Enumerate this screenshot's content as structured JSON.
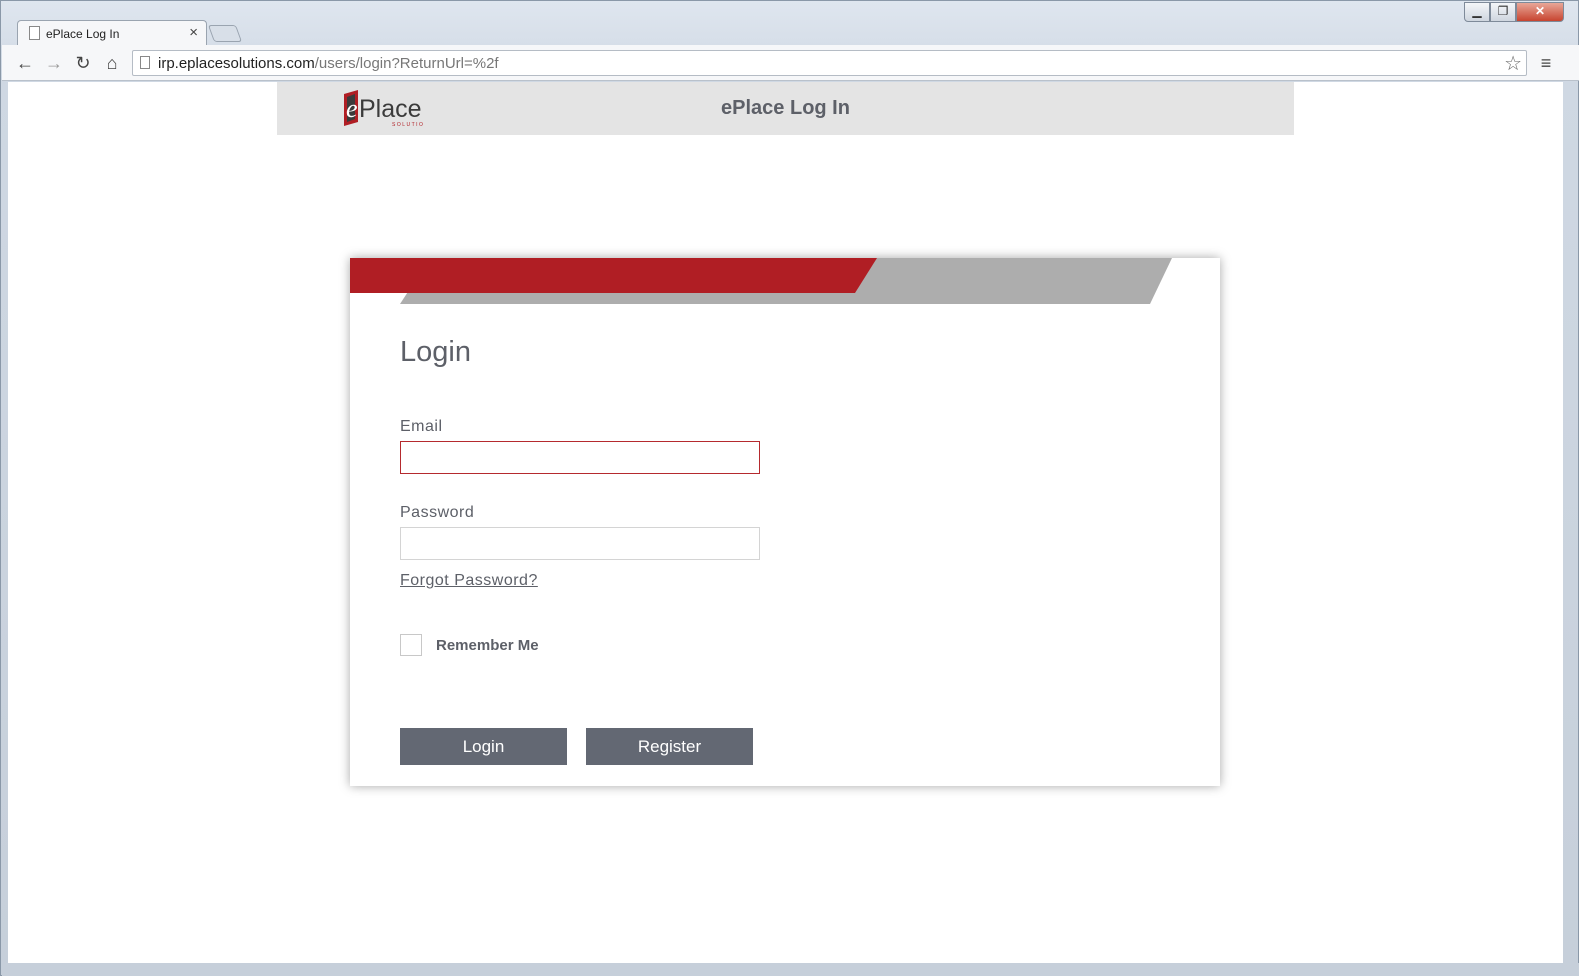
{
  "browser": {
    "tab_title": "ePlace Log In",
    "tab_close": "×",
    "url_host": "irp.eplacesolutions.com",
    "url_path": "/users/login?ReturnUrl=%2f",
    "back_glyph": "←",
    "forward_glyph": "→",
    "reload_glyph": "↻",
    "home_glyph": "⌂",
    "star_glyph": "☆",
    "menu_glyph": "≡",
    "win_min": "▁",
    "win_max": "❐",
    "win_close": "✕"
  },
  "header": {
    "logo_text": "ePlace",
    "logo_subtext": "SOLUTIONS",
    "title": "ePlace Log In"
  },
  "form": {
    "title": "Login",
    "email_label": "Email",
    "email_value": "",
    "password_label": "Password",
    "password_value": "",
    "forgot_link": "Forgot Password?",
    "remember_label": "Remember Me",
    "remember_checked": false,
    "login_button": "Login",
    "register_button": "Register"
  },
  "colors": {
    "brand_red": "#b01e24",
    "banner_gray": "#adadad",
    "button_gray": "#636873",
    "text_gray": "#5d6068",
    "header_bg": "#e4e4e4"
  }
}
